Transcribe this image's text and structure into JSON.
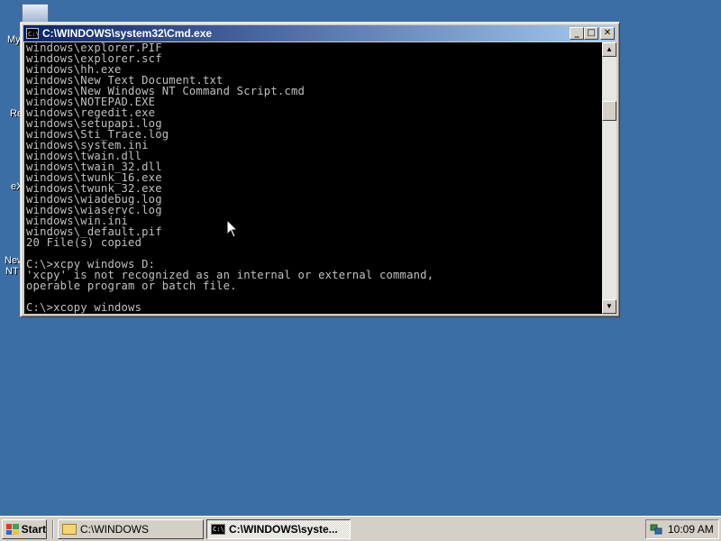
{
  "desktop": {
    "icons": [
      {
        "label": "My"
      },
      {
        "label": "Re"
      },
      {
        "label": "eX"
      },
      {
        "label": "New"
      },
      {
        "label": "NT"
      }
    ]
  },
  "window": {
    "title": "C:\\WINDOWS\\system32\\Cmd.exe",
    "title_icon_text": "C:\\",
    "buttons": {
      "minimize": "_",
      "maximize": "□",
      "close": "✕"
    },
    "console_lines": [
      "windows\\explorer.PIF",
      "windows\\explorer.scf",
      "windows\\hh.exe",
      "windows\\New Text Document.txt",
      "windows\\New Windows NT Command Script.cmd",
      "windows\\NOTEPAD.EXE",
      "windows\\regedit.exe",
      "windows\\setupapi.log",
      "windows\\Sti_Trace.log",
      "windows\\system.ini",
      "windows\\twain.dll",
      "windows\\twain_32.dll",
      "windows\\twunk_16.exe",
      "windows\\twunk_32.exe",
      "windows\\wiadebug.log",
      "windows\\wiaservc.log",
      "windows\\win.ini",
      "windows\\_default.pif",
      "20 File(s) copied",
      "",
      "C:\\>xcpy windows D:",
      "'xcpy' is not recognized as an internal or external command,",
      "operable program or batch file.",
      "",
      "C:\\>xcopy windows"
    ],
    "scrollbar": {
      "up_arrow": "▲",
      "down_arrow": "▼"
    }
  },
  "taskbar": {
    "start_label": "Start",
    "tasks": [
      {
        "label": "C:\\WINDOWS",
        "icon": "folder-icon",
        "active": false
      },
      {
        "label": "C:\\WINDOWS\\syste...",
        "icon": "cmd-icon",
        "active": true
      }
    ],
    "clock": "10:09 AM"
  }
}
